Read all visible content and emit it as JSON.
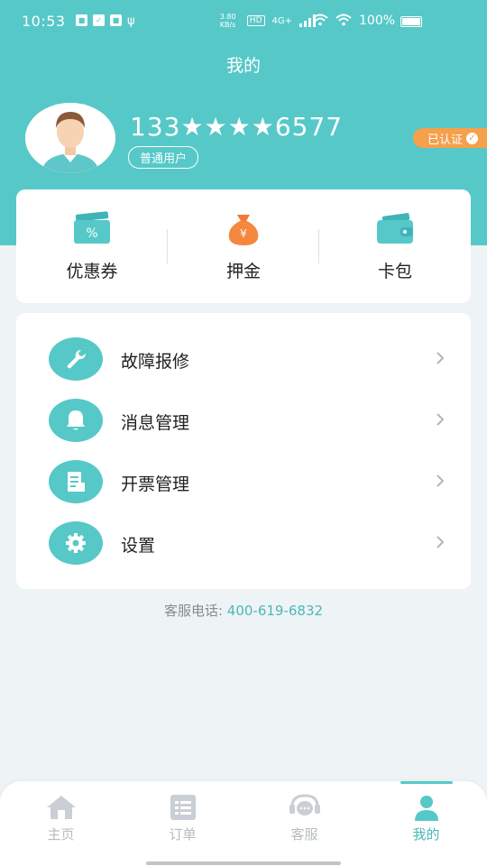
{
  "status_bar": {
    "time": "10:53",
    "net_speed": "3.80 KB/s",
    "hd_label": "HD",
    "network_label": "4G+",
    "battery": "100%"
  },
  "header": {
    "title": "我的"
  },
  "profile": {
    "phone": "133★★★★6577",
    "user_type": "普通用户",
    "verified_label": "已认证"
  },
  "wallet": {
    "items": [
      {
        "label": "优惠券",
        "icon": "coupon-icon"
      },
      {
        "label": "押金",
        "icon": "money-bag-icon"
      },
      {
        "label": "卡包",
        "icon": "wallet-icon"
      }
    ]
  },
  "menu": {
    "items": [
      {
        "label": "故障报修",
        "icon": "wrench-icon"
      },
      {
        "label": "消息管理",
        "icon": "bell-icon"
      },
      {
        "label": "开票管理",
        "icon": "invoice-icon"
      },
      {
        "label": "设置",
        "icon": "gear-icon"
      }
    ]
  },
  "hotline": {
    "label": "客服电话: ",
    "number": "400-619-6832"
  },
  "tab_bar": {
    "items": [
      {
        "label": "主页",
        "icon": "home-icon",
        "active": false
      },
      {
        "label": "订单",
        "icon": "order-list-icon",
        "active": false
      },
      {
        "label": "客服",
        "icon": "customer-service-icon",
        "active": false
      },
      {
        "label": "我的",
        "icon": "person-icon",
        "active": true
      }
    ]
  },
  "colors": {
    "accent": "#56c8c8",
    "badge": "#f5a04b",
    "background": "#eef3f6"
  }
}
